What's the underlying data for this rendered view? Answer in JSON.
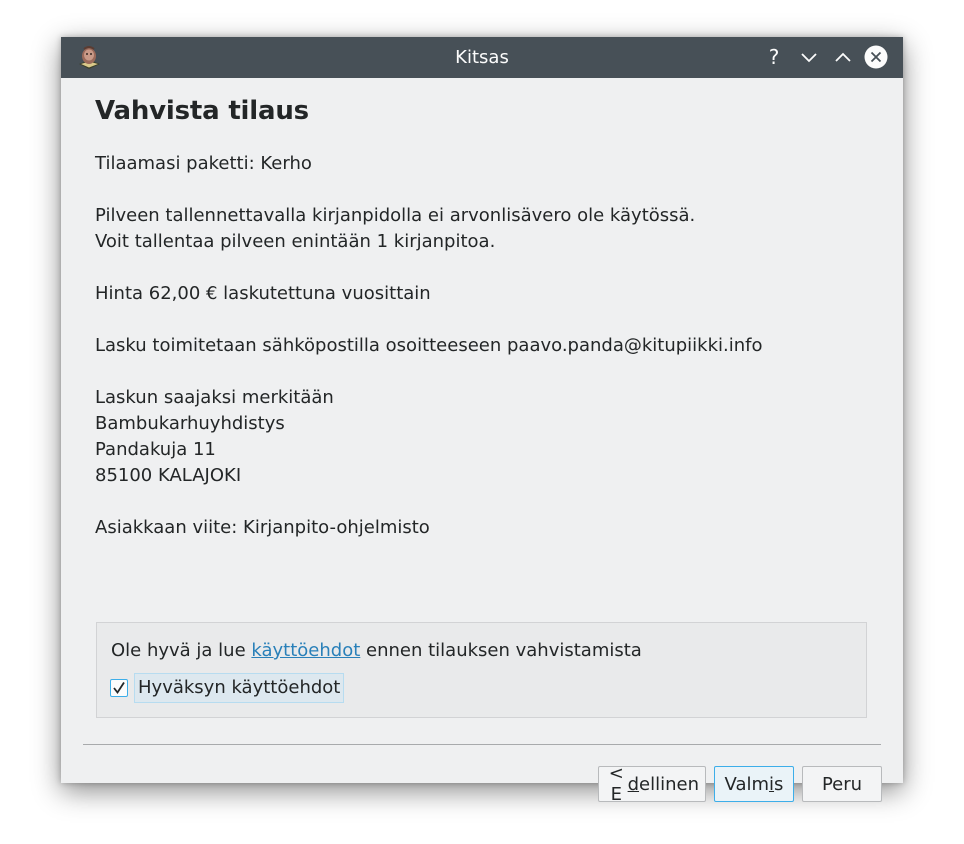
{
  "window": {
    "title": "Kitsas",
    "help_glyph": "?",
    "icons": [
      "kitsas-app-icon",
      "help-icon",
      "minimize-icon",
      "maximize-icon",
      "close-icon"
    ]
  },
  "page": {
    "heading": "Vahvista tilaus",
    "package_line": "Tilaamasi paketti: Kerho",
    "vat_line": "Pilveen tallennettavalla kirjanpidolla ei arvonlisävero ole käytössä.",
    "limit_line": "Voit tallentaa pilveen enintään 1 kirjanpitoa.",
    "price_line": "Hinta 62,00 € laskutettuna vuosittain",
    "invoice_line": "Lasku toimitetaan sähköpostilla osoitteeseen paavo.panda@kitupiikki.info",
    "recipient_heading": "Laskun saajaksi merkitään",
    "recipient_name": "Bambukarhuyhdistys",
    "recipient_street": "Pandakuja 11",
    "recipient_postal": "85100 KALAJOKI",
    "reference_line": "Asiakkaan viite: Kirjanpito-ohjelmisto"
  },
  "terms": {
    "prefix": "Ole hyvä ja lue ",
    "link": "käyttöehdot",
    "suffix": " ennen tilauksen vahvistamista",
    "checkbox_label": "Hyväksyn käyttöehdot",
    "checked": true
  },
  "buttons": {
    "prev_pre": "< E",
    "prev_mnemonic": "d",
    "prev_post": "ellinen",
    "ok_pre": "Valm",
    "ok_mnemonic": "i",
    "ok_post": "s",
    "cancel": "Peru"
  },
  "colors": {
    "titlebar": "#475057",
    "window_bg": "#eff0f1",
    "link": "#2980b9",
    "focus": "#3daee9"
  }
}
